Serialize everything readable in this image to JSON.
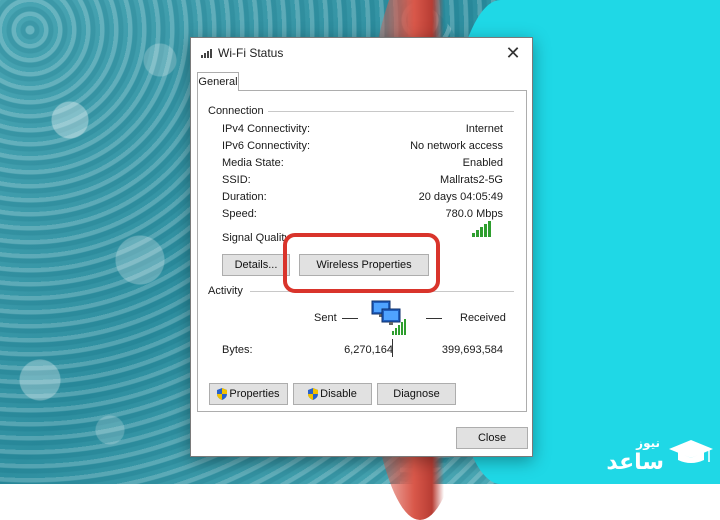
{
  "dialog": {
    "title": "Wi-Fi Status",
    "tab": "General",
    "connection": {
      "heading": "Connection",
      "rows": [
        {
          "label": "IPv4 Connectivity:",
          "value": "Internet"
        },
        {
          "label": "IPv6 Connectivity:",
          "value": "No network access"
        },
        {
          "label": "Media State:",
          "value": "Enabled"
        },
        {
          "label": "SSID:",
          "value": "Mallrats2-5G"
        },
        {
          "label": "Duration:",
          "value": "20 days 04:05:49"
        },
        {
          "label": "Speed:",
          "value": "780.0 Mbps"
        }
      ],
      "signal_label": "Signal Quality"
    },
    "buttons": {
      "details": "Details...",
      "wireless_properties": "Wireless Properties",
      "properties": "Properties",
      "disable": "Disable",
      "diagnose": "Diagnose",
      "close": "Close"
    },
    "activity": {
      "heading": "Activity",
      "sent_label": "Sent",
      "received_label": "Received",
      "bytes_label": "Bytes:",
      "bytes_sent": "6,270,164",
      "bytes_received": "399,693,584"
    }
  },
  "watermark": {
    "line1": "نیوز",
    "line2": "ساعد"
  },
  "colors": {
    "highlight": "#d9342b",
    "signal": "#2e9e2e",
    "background_cyan": "#1fd8e6"
  }
}
